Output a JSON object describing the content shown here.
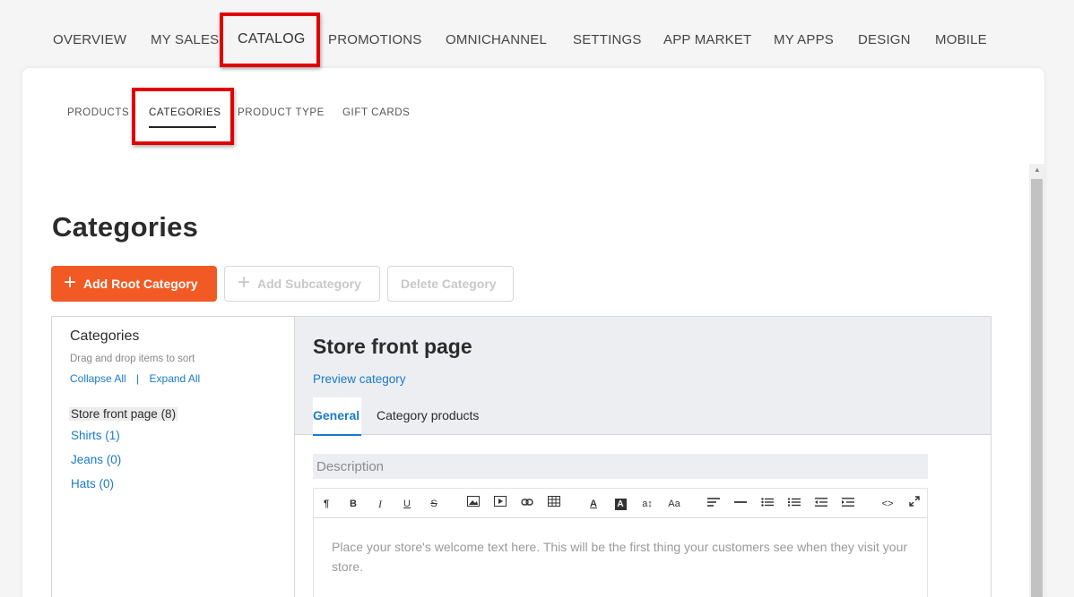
{
  "top_nav": [
    {
      "label": "OVERVIEW"
    },
    {
      "label": "MY SALES"
    },
    {
      "label": "CATALOG"
    },
    {
      "label": "PROMOTIONS"
    },
    {
      "label": "OMNICHANNEL"
    },
    {
      "label": "SETTINGS"
    },
    {
      "label": "APP MARKET"
    },
    {
      "label": "MY APPS"
    },
    {
      "label": "DESIGN"
    },
    {
      "label": "MOBILE"
    }
  ],
  "sub_nav": [
    {
      "label": "PRODUCTS"
    },
    {
      "label": "CATEGORIES"
    },
    {
      "label": "PRODUCT TYPE"
    },
    {
      "label": "GIFT CARDS"
    }
  ],
  "page_title": "Categories",
  "actions": {
    "add_root": "Add Root Category",
    "add_sub": "Add Subcategory",
    "delete": "Delete Category"
  },
  "categories_panel": {
    "title": "Categories",
    "hint": "Drag and drop items to sort",
    "collapse_all": "Collapse All",
    "separator": "|",
    "expand_all": "Expand All",
    "items": [
      {
        "label": "Store front page (8)"
      },
      {
        "label": "Shirts (1)"
      },
      {
        "label": "Jeans (0)"
      },
      {
        "label": "Hats (0)"
      }
    ]
  },
  "detail": {
    "title": "Store front page",
    "preview_link": "Preview category",
    "tabs": [
      {
        "label": "General"
      },
      {
        "label": "Category products"
      }
    ],
    "description_label": "Description",
    "editor_placeholder": "Place your store's welcome text here. This will be the first thing your customers see when they visit your store."
  },
  "toolbar_icons": [
    "paragraph-icon",
    "bold-icon",
    "italic-icon",
    "underline-icon",
    "strikethrough-icon",
    "image-icon",
    "video-icon",
    "link-icon",
    "table-icon",
    "font-color-icon",
    "background-color-icon",
    "font-size-icon",
    "font-family-icon",
    "align-icon",
    "horizontal-rule-icon",
    "bullet-list-icon",
    "numbered-list-icon",
    "outdent-icon",
    "indent-icon",
    "code-view-icon",
    "fullscreen-icon"
  ],
  "colors": {
    "accent": "#f15a24",
    "link": "#1a7ac8",
    "highlight": "#e00000"
  }
}
